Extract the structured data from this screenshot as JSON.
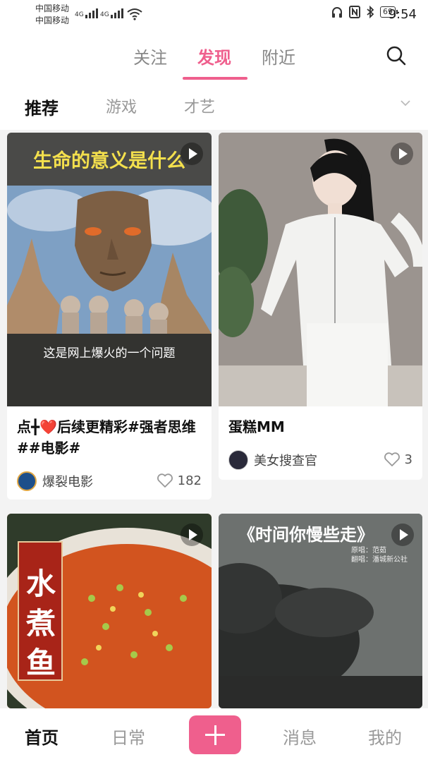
{
  "status": {
    "carrier1": "中国移动",
    "carrier2": "中国移动",
    "net1": "4G",
    "net2": "4G",
    "battery": "69",
    "time": "9:54"
  },
  "topnav": {
    "tabs": [
      "关注",
      "发现",
      "附近"
    ],
    "active": "发现"
  },
  "categories": {
    "items": [
      "推荐",
      "游戏",
      "才艺"
    ],
    "active": "推荐"
  },
  "feed": [
    {
      "overlay_title": "生命的意义是什么",
      "overlay_caption": "这是网上爆火的一个问题",
      "title": "点╋❤️后续更精彩#强者思维##电影#",
      "author": "爆裂电影",
      "likes": "182"
    },
    {
      "title": "蛋糕MM",
      "author": "美女搜查官",
      "likes": "3"
    },
    {
      "overlay_title": "水煮鱼"
    },
    {
      "overlay_title": "《时间你慢些走》",
      "credit1": "原唱：范茹",
      "credit2": "翻唱：潘城新公社"
    }
  ],
  "bottombar": {
    "home": "首页",
    "daily": "日常",
    "messages": "消息",
    "me": "我的"
  },
  "colors": {
    "accent": "#ef5f8d",
    "background": "#f3f3f3"
  }
}
